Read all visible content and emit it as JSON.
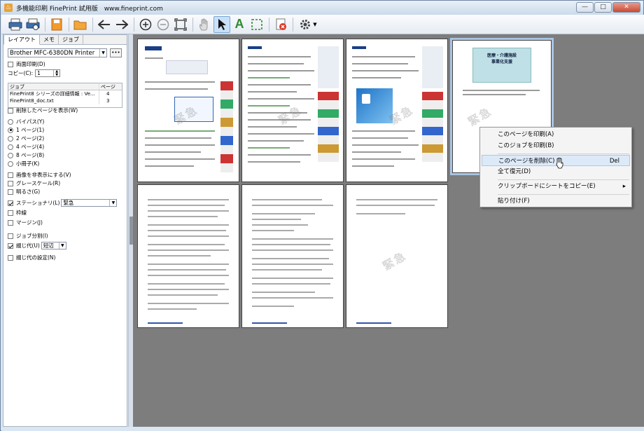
{
  "window": {
    "title": "多機能印刷 FinePrint 試用版　www.fineprint.com",
    "app_icon_glyph": "♨"
  },
  "toolbar": {
    "icons": [
      "print-icon",
      "print-preview-icon",
      "save-icon",
      "open-folder-icon",
      "back-arrow-icon",
      "forward-arrow-icon",
      "zoom-in-icon",
      "zoom-out-icon",
      "fit-page-icon",
      "hand-tool-icon",
      "select-arrow-icon",
      "text-tool-icon",
      "marquee-select-icon",
      "delete-page-icon",
      "settings-gear-icon"
    ],
    "text_tool_glyph": "A"
  },
  "sidebar": {
    "tabs": [
      "レイアウト",
      "メモ",
      "ジョブ"
    ],
    "printer": "Brother MFC-6380DN Printer",
    "more_button": "•••",
    "duplex_label": "両面印刷(D)",
    "copies_label": "コピー(C):",
    "copies_value": "1",
    "jobs_header": [
      "ジョブ",
      "ページ"
    ],
    "jobs": [
      {
        "name": "FinePrint8 シリーズの詳細情報 : Ve...",
        "pages": "4"
      },
      {
        "name": "FinePrint8_doc.txt",
        "pages": "3"
      }
    ],
    "show_deleted": "削除したページを表示(W)",
    "layouts": [
      "バイパス(Y)",
      "1 ページ(1)",
      "2 ページ(2)",
      "4 ページ(4)",
      "8 ページ(8)",
      "小冊子(K)"
    ],
    "selected_layout_index": 1,
    "hide_images": "画像を非表示にする(V)",
    "grayscale": "グレースケール(R)",
    "lighter": "明るさ(G)",
    "stationery": "ステーショナリ(L)",
    "stationery_value": "緊急",
    "frame": "枠線",
    "margin": "マージン(J)",
    "job_split": "ジョブ分割(I)",
    "binding": "綴じ代(U)",
    "binding_value": "短辺",
    "binding_settings": "綴じ代の設定(N)"
  },
  "canvas": {
    "watermark": "緊急",
    "brochure_title": "医療・介護施設\n事業化支援"
  },
  "context_menu": {
    "items": [
      {
        "label": "このページを印刷(A)",
        "shortcut": ""
      },
      {
        "label": "このジョブを印刷(B)",
        "shortcut": ""
      },
      {
        "label": "このページを削除(C)",
        "shortcut": "Del"
      },
      {
        "label": "全て復元(D)",
        "shortcut": ""
      },
      {
        "label": "クリップボードにシートをコピー(E)",
        "shortcut": "▸"
      },
      {
        "label": "貼り付け(F)",
        "shortcut": ""
      }
    ]
  },
  "colors": {
    "canvas_bg": "#7d7d7d",
    "menu_highlight": "#dce9f8",
    "accent_blue": "#2b5fa8"
  }
}
